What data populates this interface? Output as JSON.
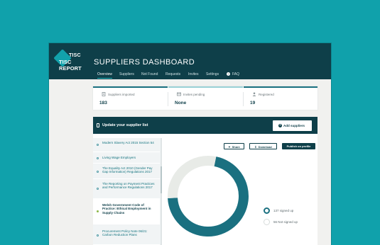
{
  "colors": {
    "background": "#10a1ab",
    "topbar": "#0e3f49",
    "accent": "#1a7080",
    "accent_light": "#e8ebe7",
    "green_dot": "#8eb849"
  },
  "header": {
    "logo_top": "TISC",
    "logo_bottom": "TISC REPORT",
    "title": "SUPPLIERS DASHBOARD",
    "nav": [
      {
        "label": "Overview",
        "active": true
      },
      {
        "label": "Suppliers",
        "active": false
      },
      {
        "label": "Not Found",
        "active": false
      },
      {
        "label": "Requests",
        "active": false
      },
      {
        "label": "Invites",
        "active": false
      },
      {
        "label": "Settings",
        "active": false
      },
      {
        "label": "FAQ",
        "active": false,
        "icon": "question-circle-icon"
      }
    ]
  },
  "stats": [
    {
      "label": "Suppliers imported",
      "value": "183",
      "bar_color": "#1a7080",
      "icon": "building-icon"
    },
    {
      "label": "Invites pending",
      "value": "None",
      "bar_color": "#9ad1d6",
      "icon": "envelope-icon"
    },
    {
      "label": "Registered",
      "value": "19",
      "bar_color": "#1a7080",
      "icon": "person-icon"
    }
  ],
  "panel": {
    "title": "Update your supplier list",
    "add_button": "Add suppliers",
    "actions": {
      "share": "Share",
      "download": "Download",
      "publish": "Publish on profile"
    }
  },
  "sidebar": {
    "items": [
      {
        "label": "Modern Slavery Act 2015 Section 54",
        "active": false
      },
      {
        "label": "Living Wage Employers",
        "active": false
      },
      {
        "label": "The Equality Act 2010 (Gender Pay Gap Information) Regulations 2017",
        "active": false
      },
      {
        "label": "The Reporting on Payment Practices and Performance Regulations 2017",
        "active": false
      },
      {
        "label": "Welsh Government Code of Practice: Ethical Employment in Supply Chains",
        "active": true
      },
      {
        "label": "Procurement Policy Note 06/21: Carbon Reduction Plans",
        "active": false
      }
    ]
  },
  "chart_data": {
    "type": "pie",
    "donut": true,
    "values": [
      137,
      56
    ],
    "labels": [
      "137 signed up",
      "56 Not signed up"
    ],
    "colors": [
      "#1a7080",
      "#e8ebe7"
    ]
  }
}
